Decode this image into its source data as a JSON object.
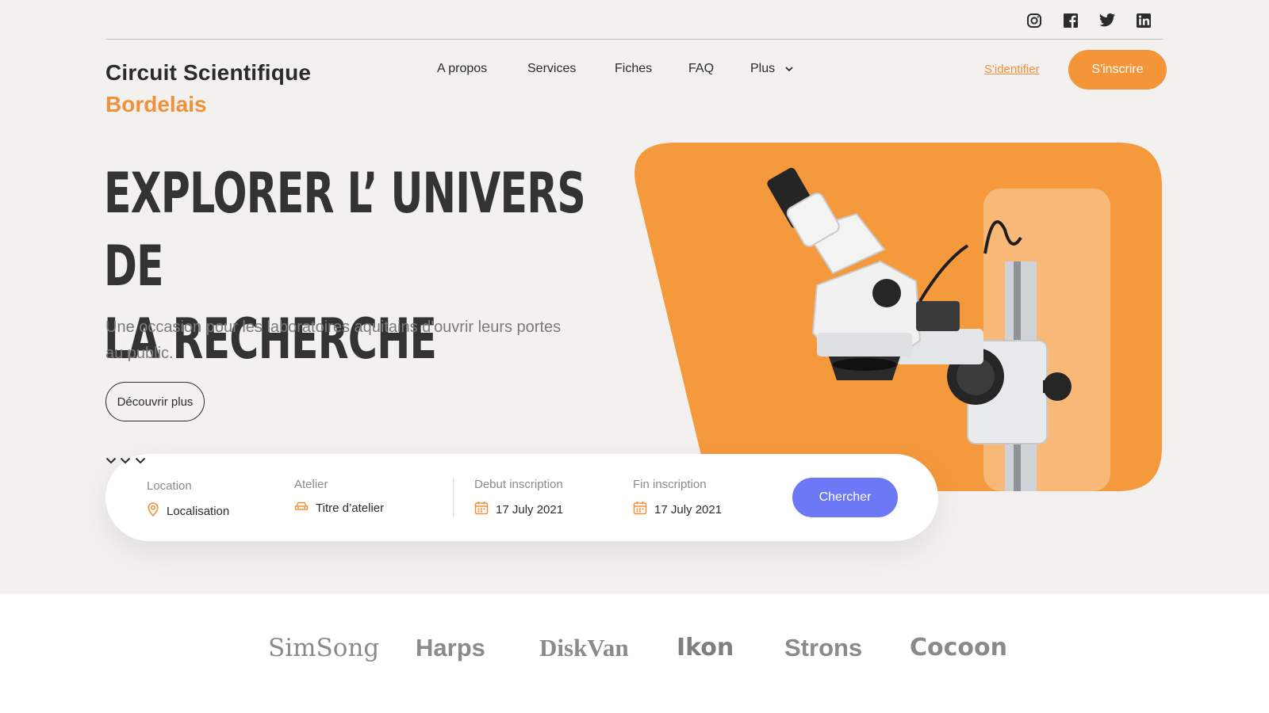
{
  "social": [
    "instagram-icon",
    "facebook-icon",
    "twitter-icon",
    "linkedin-icon"
  ],
  "brand": {
    "line1": "Circuit Scientifique",
    "line2": "Bordelais"
  },
  "nav": {
    "items": [
      "A propos",
      "Services",
      "Fiches",
      "FAQ",
      "Plus"
    ],
    "login": "S'identifier",
    "signup": "S'inscrire"
  },
  "hero": {
    "headline_line1": "EXPLORER L’ UNIVERS DE",
    "headline_line2": "LA RECHERCHE",
    "subtitle": "Une occasion pour les laboratoires aquitains d'ouvrir leurs portes au public.",
    "cta": "Découvrir plus"
  },
  "search": {
    "location": {
      "label": "Location",
      "value": "Localisation"
    },
    "atelier": {
      "label": "Atelier",
      "value": "Titre d’atelier"
    },
    "debut": {
      "label": "Debut inscription",
      "value": "17 July 2021"
    },
    "fin": {
      "label": "Fin inscription",
      "value": "17 July 2021"
    },
    "button": "Chercher"
  },
  "partners": [
    "SimSong",
    "Harps",
    "DiskVan",
    "Ikon",
    "Strons",
    "Cocoon"
  ],
  "colors": {
    "accent": "#f5953a",
    "primary_button": "#6c78f5",
    "hero_bg": "#f2f1ef",
    "text": "#2b2b2b"
  }
}
